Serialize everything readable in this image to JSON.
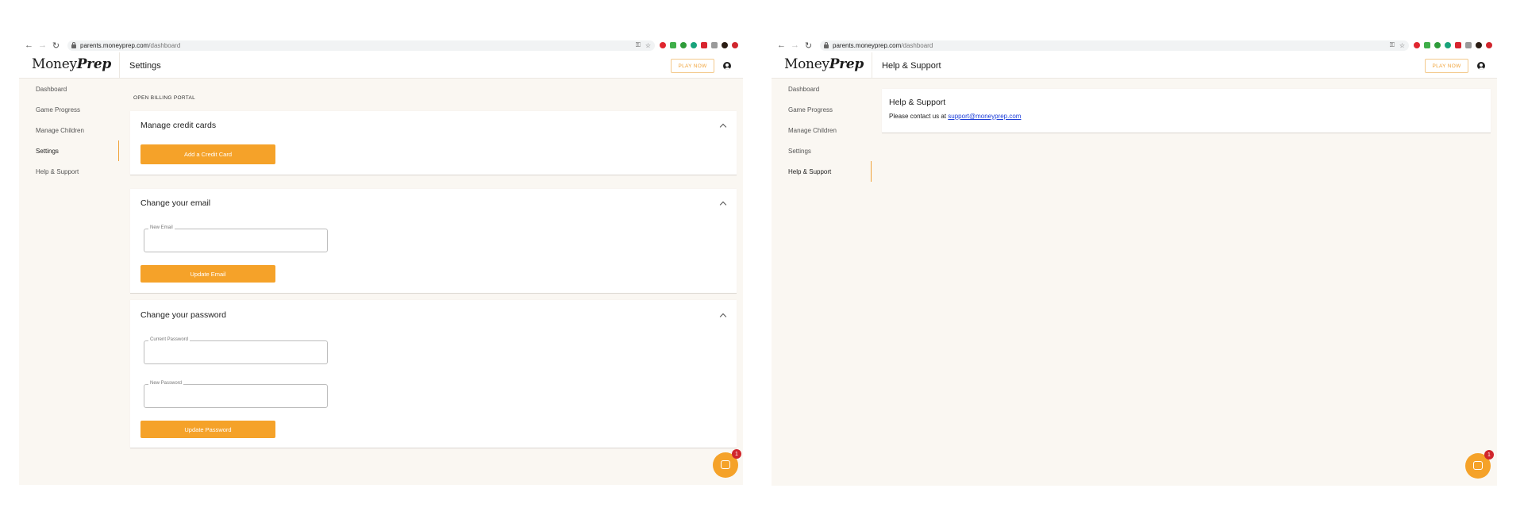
{
  "browser": {
    "back": "←",
    "forward": "→",
    "reload": "↻",
    "url_host": "parents.moneyprep.com",
    "url_path": "/dashboard",
    "key": "⚿",
    "star": "☆",
    "extension_colors": [
      "#e0262f",
      "#3fae49",
      "#2f9c3a",
      "#18a37b",
      "#d8252f",
      "#9a9a9a"
    ]
  },
  "brand": {
    "logo_regular": "Money",
    "logo_bold": "Prep"
  },
  "header": {
    "play_now": "PLAY NOW"
  },
  "sidebar": {
    "items": [
      {
        "label": "Dashboard"
      },
      {
        "label": "Game Progress"
      },
      {
        "label": "Manage Children"
      },
      {
        "label": "Settings"
      },
      {
        "label": "Help & Support"
      }
    ]
  },
  "settings_page": {
    "title": "Settings",
    "billing_link": "OPEN BILLING PORTAL",
    "credit_cards": {
      "title": "Manage credit cards",
      "add_button": "Add a Credit Card"
    },
    "email": {
      "title": "Change your email",
      "new_email_label": "New Email",
      "update_button": "Update Email"
    },
    "password": {
      "title": "Change your password",
      "current_label": "Current Password",
      "new_label": "New Password",
      "update_button": "Update Password"
    },
    "active_item": "Settings"
  },
  "help_page": {
    "title": "Help & Support",
    "card_title": "Help & Support",
    "contact_text": "Please contact us at",
    "email": "support@moneyprep.com",
    "active_item": "Help & Support"
  },
  "chat": {
    "badge_count": "1"
  },
  "colors": {
    "accent": "#f5a229",
    "background": "#faf7f2",
    "link": "#1a3cd8",
    "badge": "#d0262d"
  }
}
